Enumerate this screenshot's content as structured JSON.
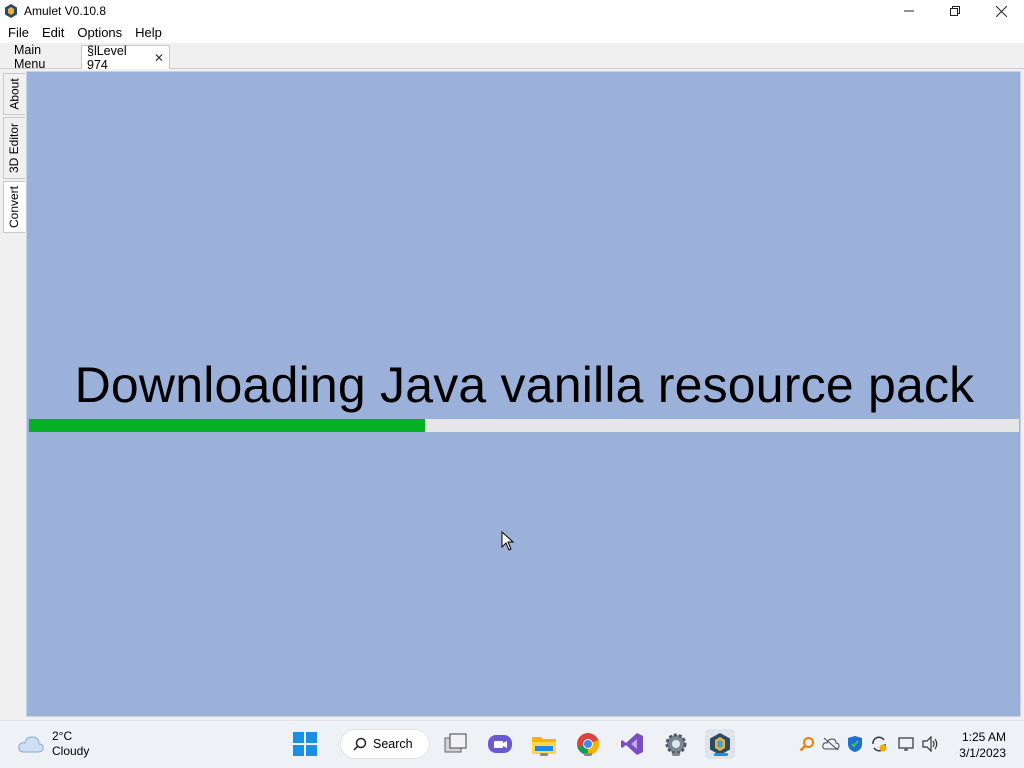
{
  "window": {
    "title": "Amulet V0.10.8",
    "controls": [
      "minimize",
      "restore",
      "close"
    ]
  },
  "menu": {
    "items": [
      "File",
      "Edit",
      "Options",
      "Help"
    ]
  },
  "tabs": {
    "main_menu": "Main Menu",
    "active": "§lLevel 974"
  },
  "side_tabs": [
    "About",
    "3D Editor",
    "Convert"
  ],
  "main": {
    "status": "Downloading Java vanilla resource pack",
    "progress_fraction": 0.4,
    "background_color": "#9bb1d9",
    "progress_color": "#06b025"
  },
  "taskbar": {
    "weather_temp": "2°C",
    "weather_desc": "Cloudy",
    "search_label": "Search",
    "apps": [
      "start-icon",
      "search-icon",
      "task-view-icon",
      "chat-icon",
      "file-explorer-icon",
      "chrome-icon",
      "visual-studio-icon",
      "settings-icon",
      "amulet-icon"
    ],
    "clock_time": "1:25 AM",
    "clock_date": "3/1/2023"
  }
}
